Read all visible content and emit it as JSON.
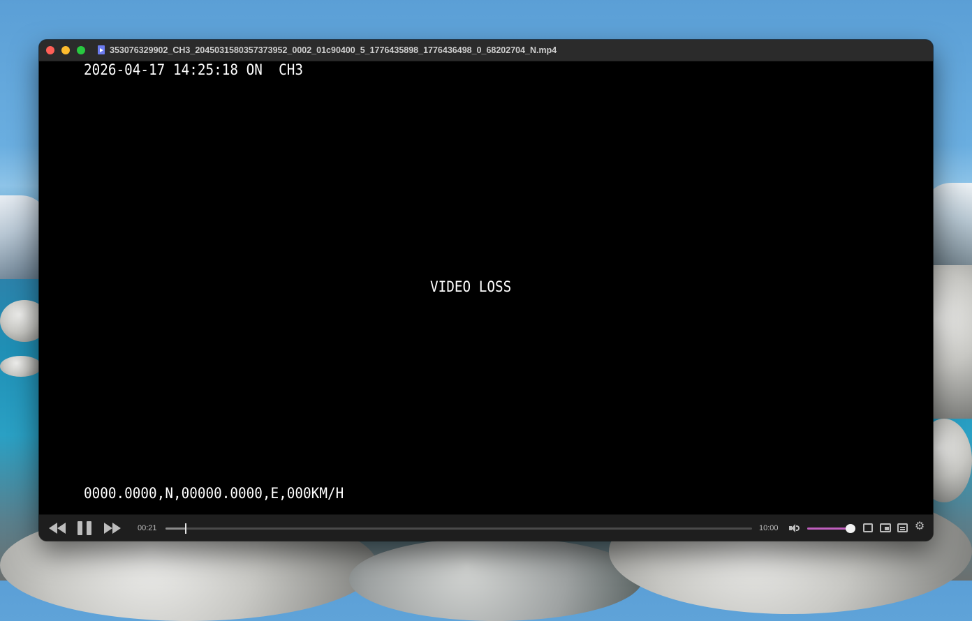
{
  "window": {
    "title": "353076329902_CH3_2045031580357373952_0002_01c90400_5_1776435898_1776436498_0_68202704_N.mp4"
  },
  "video": {
    "osd_top": "2026-04-17 14:25:18 ON  CH3",
    "osd_center": "VIDEO LOSS",
    "osd_bottom": "0000.0000,N,00000.0000,E,000KM/H"
  },
  "controls": {
    "current_time": "00:21",
    "total_time": "10:00",
    "progress_fraction": 0.035,
    "volume_fraction": 1.0,
    "icons": [
      "rewind-icon",
      "pause-icon",
      "fast-forward-icon",
      "volume-icon",
      "crop-icon",
      "picture-in-picture-icon",
      "subtitles-icon",
      "settings-gear-icon"
    ],
    "gear_glyph": "⚙"
  },
  "colors": {
    "volume_accent": "#c05fbf",
    "close": "#ff5f57",
    "minimize": "#febc2e",
    "maximize": "#28c840"
  }
}
